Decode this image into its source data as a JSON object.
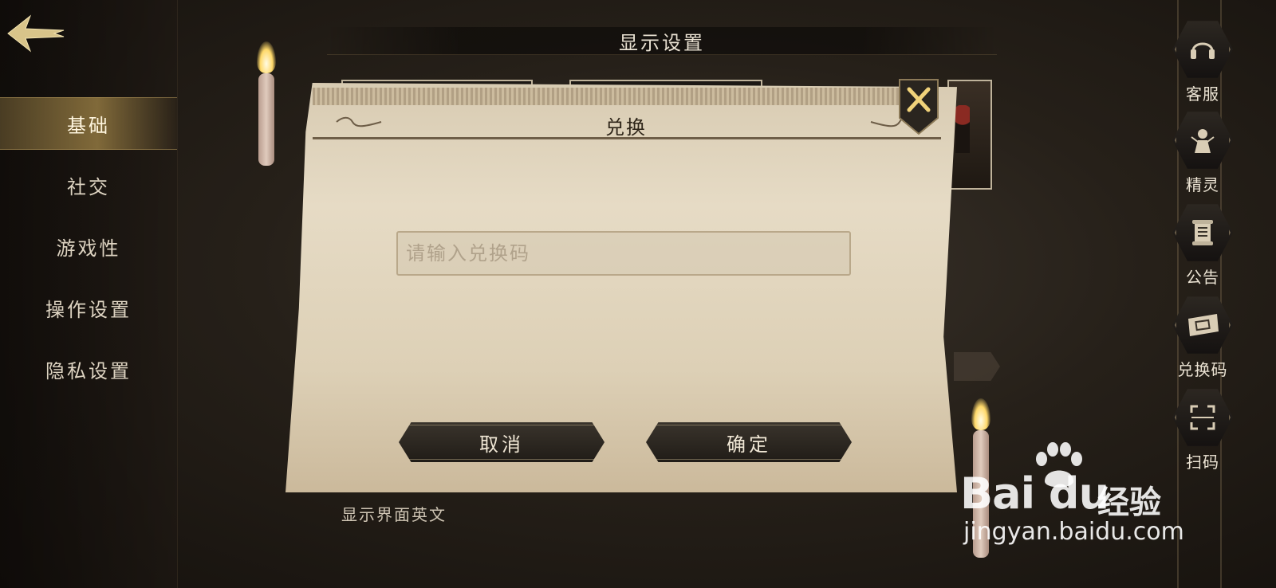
{
  "screen": {
    "title": "显示设置",
    "background_option_label": "显示界面英文"
  },
  "sidebar": {
    "back_icon": "back-arrow-icon",
    "items": [
      {
        "label": "基础",
        "active": true
      },
      {
        "label": "社交",
        "active": false
      },
      {
        "label": "游戏性",
        "active": false
      },
      {
        "label": "操作设置",
        "active": false
      },
      {
        "label": "隐私设置",
        "active": false
      }
    ]
  },
  "dialog": {
    "title": "兑换",
    "input": {
      "value": "",
      "placeholder": "请输入兑换码"
    },
    "cancel_label": "取消",
    "confirm_label": "确定",
    "close_icon": "close-icon"
  },
  "right_rail": {
    "items": [
      {
        "label": "客服",
        "icon": "headset-icon"
      },
      {
        "label": "精灵",
        "icon": "sprite-icon"
      },
      {
        "label": "公告",
        "icon": "scroll-icon"
      },
      {
        "label": "兑换码",
        "icon": "ticket-icon"
      },
      {
        "label": "扫码",
        "icon": "scan-icon"
      }
    ]
  },
  "watermark": {
    "brand": "Bai du",
    "product": "经验",
    "url": "jingyan.baidu.com"
  },
  "colors": {
    "accent_gold": "#d6b05c",
    "parchment": "#e6dbc5",
    "button_dark": "#2a251f"
  }
}
